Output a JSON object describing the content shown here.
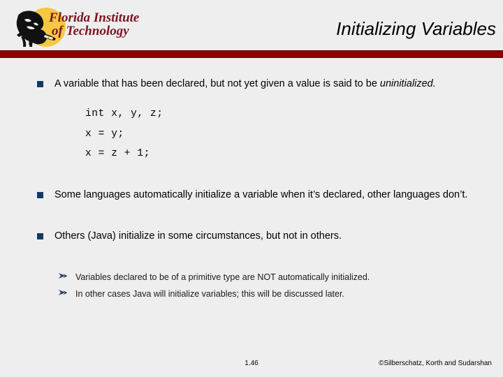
{
  "slide": {
    "header": {
      "logo": {
        "line1": "Florida Institute",
        "line2": "of Technology",
        "disc_color": "#f5c842",
        "text_color": "#7b1520",
        "icon": "panther-head-icon"
      },
      "title": "Initializing Variables",
      "rule_color": "#8d0000"
    },
    "bullets": [
      {
        "marker": "square-bullet",
        "text_plain": "A variable that has been declared, but not yet given a value is said to be ",
        "text_italic": "uninitialized."
      },
      {
        "marker": "square-bullet",
        "text_plain": "Some languages automatically initialize a variable when it’s declared, other languages don’t."
      },
      {
        "marker": "square-bullet",
        "text_plain": "Others (Java) initialize in some circumstances, but not in others."
      }
    ],
    "code": [
      "int x, y, z;",
      "x = y;",
      "x = z + 1;"
    ],
    "subbullets": [
      {
        "marker": "dart-bullet",
        "text": "Variables declared to be of a primitive type are NOT automatically initialized."
      },
      {
        "marker": "dart-bullet",
        "text": "In other cases Java will initialize variables; this will be discussed later."
      }
    ],
    "footer": {
      "page": "1.46",
      "credit": "©Silberschatz, Korth and Sudarshan"
    },
    "colors": {
      "background": "#eeeeee",
      "bullet_square": "#123a66",
      "subbullet": "#1f3864",
      "accent_rule": "#8d0000"
    }
  }
}
